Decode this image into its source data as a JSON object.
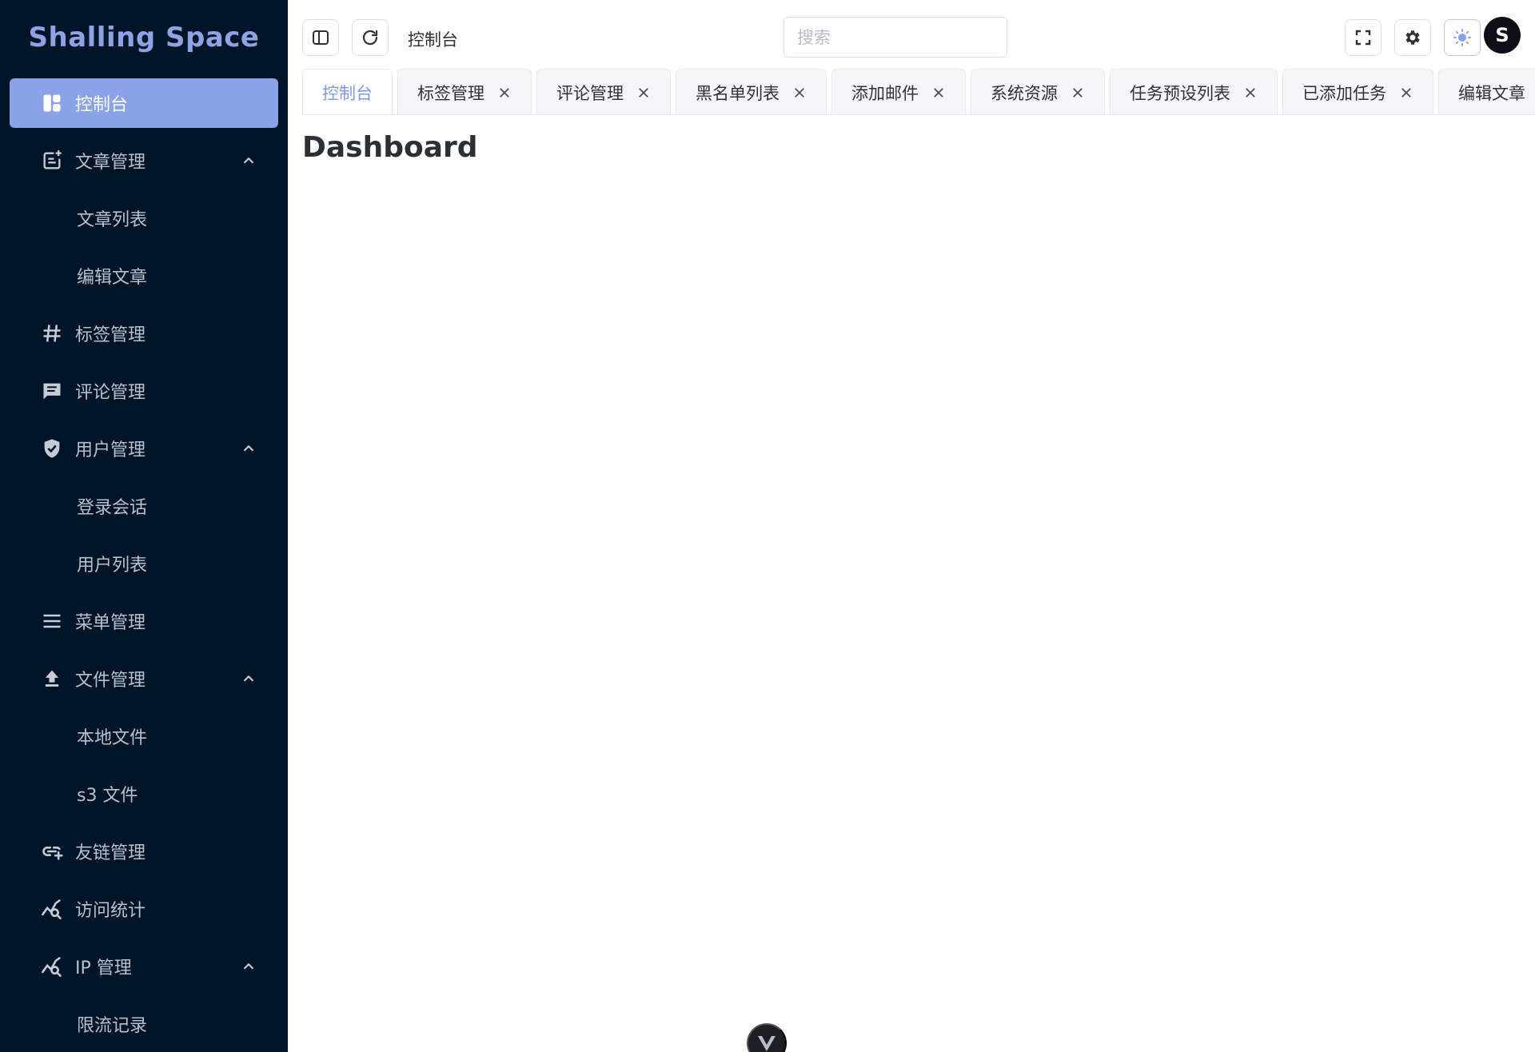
{
  "brand": {
    "name": "Shalling Space"
  },
  "sidebar": {
    "items": [
      {
        "label": "控制台",
        "icon": "dashboard-icon",
        "active": true
      },
      {
        "label": "文章管理",
        "icon": "post-add-icon",
        "expanded": true
      },
      {
        "label": "文章列表",
        "sub": true
      },
      {
        "label": "编辑文章",
        "sub": true
      },
      {
        "label": "标签管理",
        "icon": "hashtag-icon"
      },
      {
        "label": "评论管理",
        "icon": "comment-icon"
      },
      {
        "label": "用户管理",
        "icon": "shield-check-icon",
        "expanded": true
      },
      {
        "label": "登录会话",
        "sub": true
      },
      {
        "label": "用户列表",
        "sub": true
      },
      {
        "label": "菜单管理",
        "icon": "menu-lines-icon"
      },
      {
        "label": "文件管理",
        "icon": "upload-icon",
        "expanded": true
      },
      {
        "label": "本地文件",
        "sub": true
      },
      {
        "label": "s3 文件",
        "sub": true
      },
      {
        "label": "友链管理",
        "icon": "link-add-icon"
      },
      {
        "label": "访问统计",
        "icon": "chart-search-icon"
      },
      {
        "label": "IP 管理",
        "icon": "chart-search-icon",
        "expanded": true
      },
      {
        "label": "限流记录",
        "sub": true
      }
    ]
  },
  "topbar": {
    "breadcrumb": "控制台",
    "search_placeholder": "搜索",
    "avatar_letter": "S"
  },
  "tabs": [
    {
      "label": "控制台",
      "active": true,
      "closable": false
    },
    {
      "label": "标签管理",
      "closable": true
    },
    {
      "label": "评论管理",
      "closable": true
    },
    {
      "label": "黑名单列表",
      "closable": true
    },
    {
      "label": "添加邮件",
      "closable": true
    },
    {
      "label": "系统资源",
      "closable": true
    },
    {
      "label": "任务预设列表",
      "closable": true
    },
    {
      "label": "已添加任务",
      "closable": true
    },
    {
      "label": "编辑文章",
      "closable": true
    }
  ],
  "page": {
    "title": "Dashboard"
  },
  "colors": {
    "sidebar_bg": "#001428",
    "accent": "#8aa2e8",
    "brand_text": "#8ea2e6",
    "tab_active_text": "#7f9be6"
  }
}
